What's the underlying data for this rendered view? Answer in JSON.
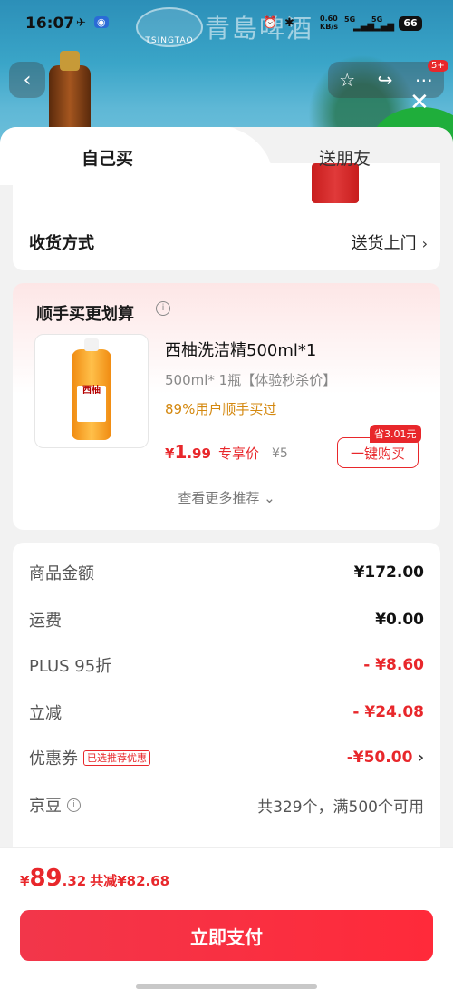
{
  "status_bar": {
    "time": "16:07",
    "network_speed": "0.60\nKB/s",
    "signal1": "5G",
    "signal2": "5G",
    "battery": "66"
  },
  "background": {
    "brand_logo": "TSINGTAO",
    "brand_name": "青島啤酒",
    "cart_badge": "5+"
  },
  "tabs": [
    {
      "label": "自己买",
      "active": true
    },
    {
      "label": "送朋友",
      "active": false
    }
  ],
  "shipping": {
    "label": "收货方式",
    "value": "送货上门"
  },
  "recommend": {
    "title": "顺手买更划算",
    "product": {
      "name": "西柚洗洁精500ml*1",
      "spec": "500ml* 1瓶【体验秒杀价】",
      "buyers": "89%用户顺手买过",
      "price_yen": "¥",
      "price_int": "1",
      "price_dec": ".99",
      "price_tag": "专享价",
      "orig_price": "¥5",
      "save_tag": "省3.01元",
      "buy_label": "一键购买",
      "bottle_label": "西柚"
    },
    "more_label": "查看更多推荐"
  },
  "price_details": [
    {
      "key": "商品金额",
      "value": "¥172.00",
      "style": ""
    },
    {
      "key": "运费",
      "value": "¥0.00",
      "style": ""
    },
    {
      "key": "PLUS 95折",
      "value": "- ¥8.60",
      "style": "red"
    },
    {
      "key": "立减",
      "value": "- ¥24.08",
      "style": "red"
    },
    {
      "key": "优惠券",
      "tag": "已选推荐优惠",
      "value": "-¥50.00",
      "style": "red"
    },
    {
      "key": "京豆",
      "value": "共329个，满500个可用",
      "style": "gray"
    }
  ],
  "footer": {
    "total_yen": "¥",
    "total_int": "89",
    "total_dec": ".32",
    "total_saving": "共减¥82.68",
    "pay_label": "立即支付"
  },
  "colors": {
    "accent": "#e8272b",
    "buyers": "#d4880f"
  }
}
